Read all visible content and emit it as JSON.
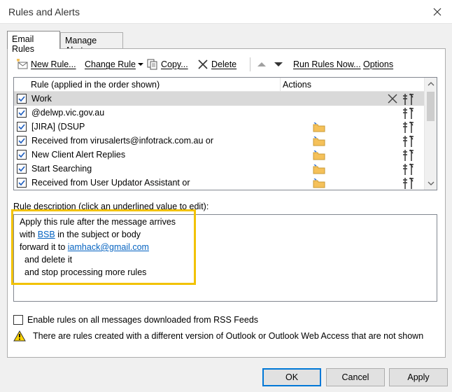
{
  "window": {
    "title": "Rules and Alerts"
  },
  "tabs": [
    {
      "label": "Email Rules",
      "active": true
    },
    {
      "label": "Manage Alerts",
      "active": false
    }
  ],
  "toolbar": {
    "new_rule": "New Rule...",
    "change_rule": "Change Rule",
    "copy": "Copy...",
    "delete": "Delete",
    "run_rules_now": "Run Rules Now...",
    "options": "Options"
  },
  "rules_list": {
    "header_rule": "Rule (applied in the order shown)",
    "header_actions": "Actions",
    "rows": [
      {
        "name": "Work",
        "checked": true,
        "selected": true,
        "forward_icon": false,
        "delete_icon": true
      },
      {
        "name": "@delwp.vic.gov.au",
        "checked": true,
        "selected": false,
        "forward_icon": false,
        "delete_icon": false
      },
      {
        "name": "[JIRA] (DSUP",
        "checked": true,
        "selected": false,
        "forward_icon": true,
        "delete_icon": false
      },
      {
        "name": "Received from virusalerts@infotrack.com.au or",
        "checked": true,
        "selected": false,
        "forward_icon": true,
        "delete_icon": false
      },
      {
        "name": "New Client Alert Replies",
        "checked": true,
        "selected": false,
        "forward_icon": true,
        "delete_icon": false
      },
      {
        "name": "Start Searching",
        "checked": true,
        "selected": false,
        "forward_icon": true,
        "delete_icon": false
      },
      {
        "name": "Received from User Updator Assistant or",
        "checked": true,
        "selected": false,
        "forward_icon": true,
        "delete_icon": false
      }
    ]
  },
  "description": {
    "label": "Rule description (click an underlined value to edit):",
    "line1": "Apply this rule after the message arrives",
    "line2_prefix": "with ",
    "line2_link": "BSB",
    "line2_suffix": " in the subject or body",
    "line3_prefix": "forward it to ",
    "line3_link": "iamhack@gmail.com",
    "line4": "and delete it",
    "line5": "and stop processing more rules",
    "highlight_color": "#f2c200"
  },
  "rss": {
    "label": "Enable rules on all messages downloaded from RSS Feeds",
    "checked": false
  },
  "warning": {
    "text": "There are rules created with a different version of Outlook or Outlook Web Access that are not shown"
  },
  "buttons": {
    "ok": "OK",
    "cancel": "Cancel",
    "apply": "Apply"
  },
  "colors": {
    "link": "#0563c1",
    "selected_row": "#d9d9d9",
    "folder": "#f5c15a",
    "arrow_blue": "#2a6fd6"
  }
}
